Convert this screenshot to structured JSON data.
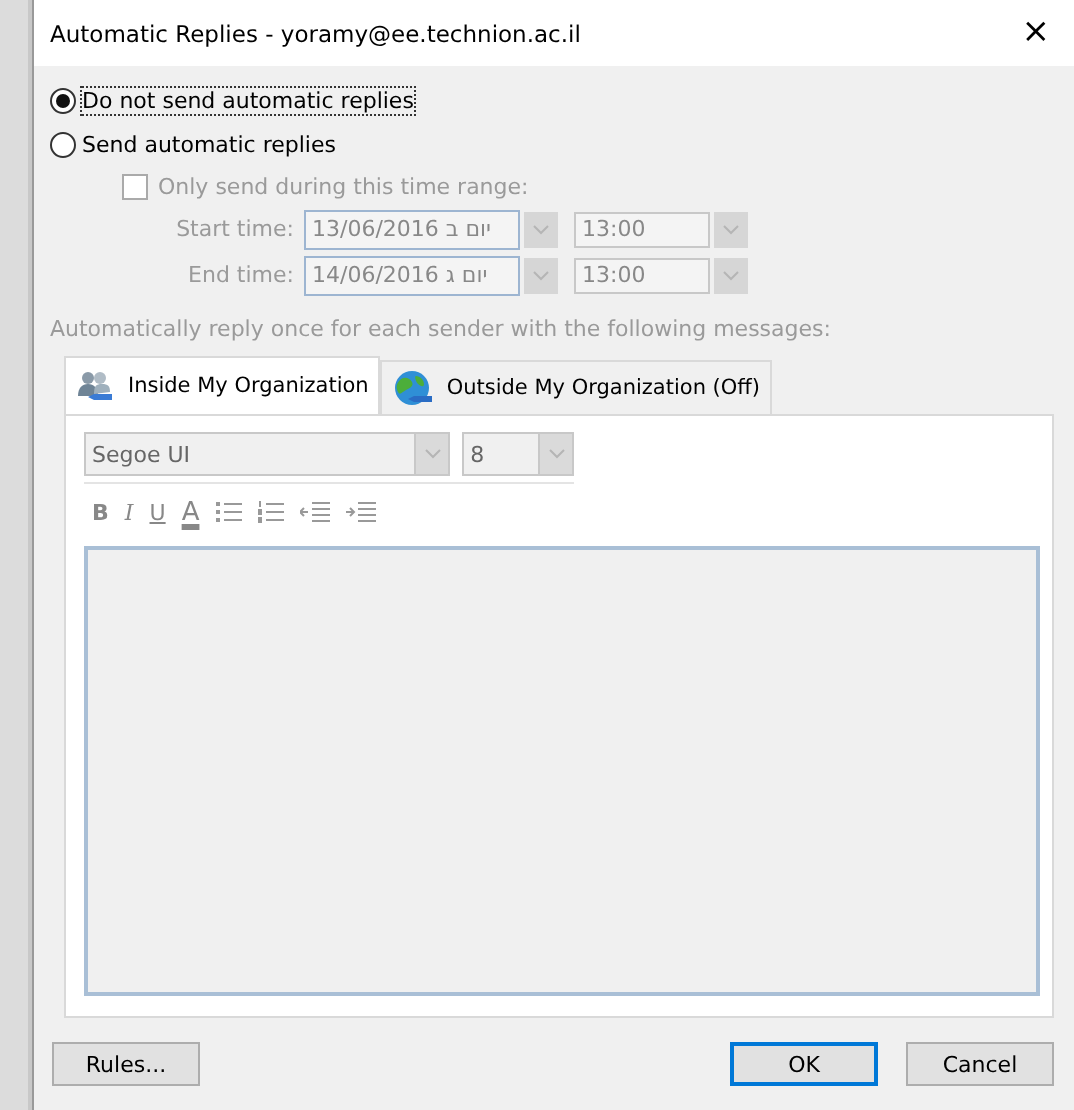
{
  "window": {
    "title": "Automatic Replies - yoramy@ee.technion.ac.il",
    "close": "×"
  },
  "reply_mode": [
    {
      "label": "Do not send automatic replies",
      "selected": true
    },
    {
      "label": "Send automatic replies",
      "selected": false
    }
  ],
  "time_range": {
    "label": "Only send during this time range:",
    "checked": false,
    "disabled": true,
    "rows": [
      {
        "label": "Start time:",
        "date": "יום ב 13/06/2016",
        "time": "13:00"
      },
      {
        "label": "End time:",
        "date": "יום ג 14/06/2016",
        "time": "13:00"
      }
    ]
  },
  "info": "Automatically reply once for each sender with the following messages:",
  "tabs": [
    {
      "label": "Inside My Organization",
      "kind": "people",
      "selected": true
    },
    {
      "label": "Outside My Organization (Off)",
      "kind": "globe",
      "selected": false
    }
  ],
  "editor": {
    "font": "Segoe UI",
    "size": "8",
    "disabled": true,
    "tools": [
      {
        "kind": "text",
        "label": "B"
      },
      {
        "kind": "text",
        "label": "I"
      },
      {
        "kind": "text",
        "label": "U"
      },
      {
        "kind": "text",
        "label": "A"
      },
      {
        "kind": "bullets"
      },
      {
        "kind": "numbering"
      },
      {
        "kind": "outdent"
      },
      {
        "kind": "indent"
      }
    ]
  },
  "buttons": [
    {
      "label": "Rules...",
      "default": false
    },
    {
      "label": "OK",
      "default": true
    },
    {
      "label": "Cancel",
      "default": false
    }
  ]
}
